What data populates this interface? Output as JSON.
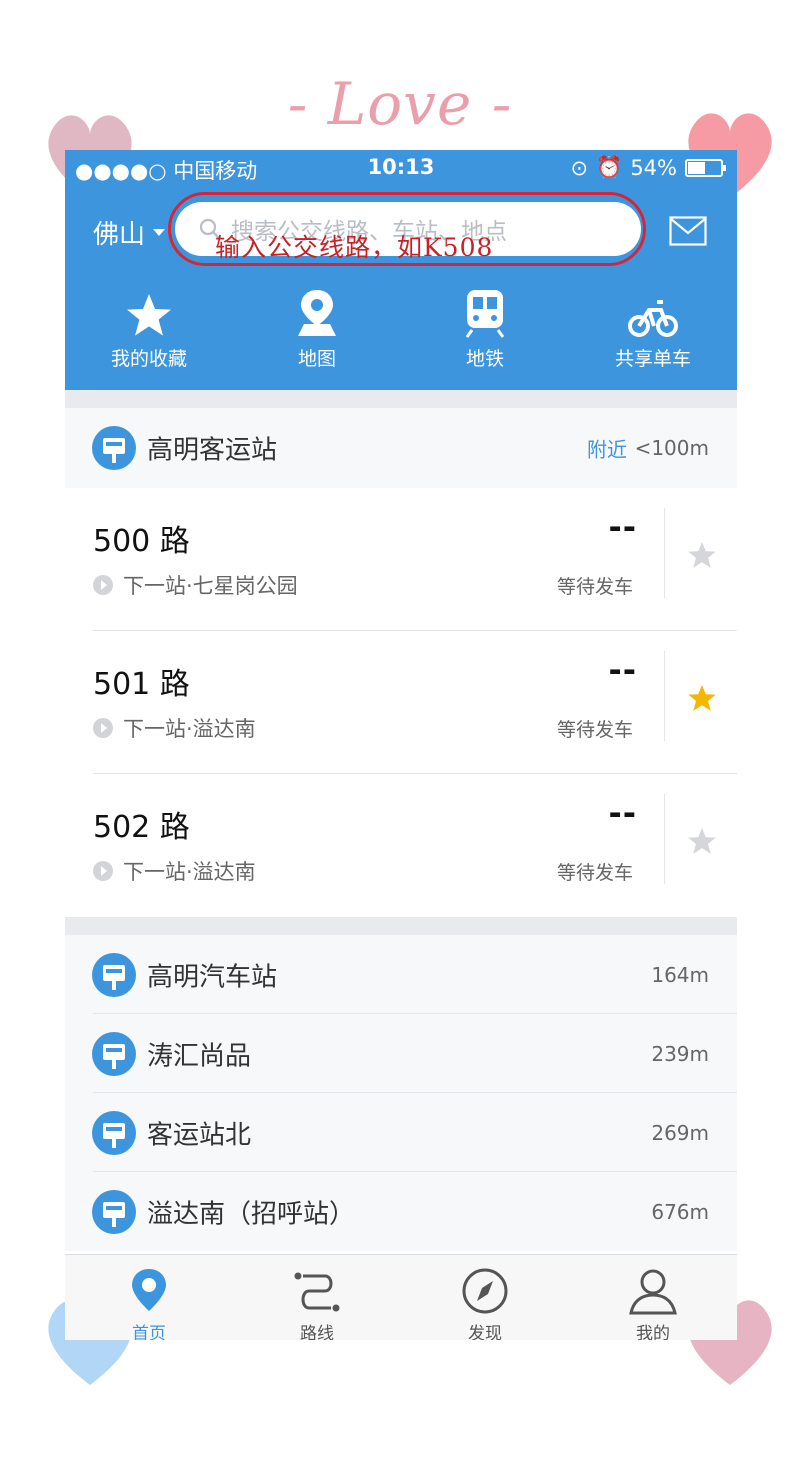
{
  "decor": {
    "love_text": "- Love -"
  },
  "status_bar": {
    "carrier": "●●●●○ 中国移动",
    "time": "10:13",
    "battery": "54%"
  },
  "header": {
    "city": "佛山",
    "search_placeholder": "搜索公交线路、车站、地点",
    "annotation": "输入公交线路，如K508"
  },
  "nav": [
    {
      "label": "我的收藏",
      "icon": "star-icon"
    },
    {
      "label": "地图",
      "icon": "map-pin-icon"
    },
    {
      "label": "地铁",
      "icon": "subway-icon"
    },
    {
      "label": "共享单车",
      "icon": "bicycle-icon"
    }
  ],
  "nearest_station": {
    "name": "高明客运站",
    "nearby_label": "附近",
    "distance": "<100m"
  },
  "routes": [
    {
      "number": "500 路",
      "next": "下一站·七星岗公园",
      "eta": "--",
      "status": "等待发车",
      "favorited": false
    },
    {
      "number": "501 路",
      "next": "下一站·溢达南",
      "eta": "--",
      "status": "等待发车",
      "favorited": true
    },
    {
      "number": "502 路",
      "next": "下一站·溢达南",
      "eta": "--",
      "status": "等待发车",
      "favorited": false
    }
  ],
  "stations": [
    {
      "name": "高明汽车站",
      "distance": "164m"
    },
    {
      "name": "涛汇尚品",
      "distance": "239m"
    },
    {
      "name": "客运站北",
      "distance": "269m"
    },
    {
      "name": "溢达南（招呼站）",
      "distance": "676m"
    }
  ],
  "tabs": [
    {
      "label": "首页",
      "icon": "home-pin-icon",
      "active": true
    },
    {
      "label": "路线",
      "icon": "route-icon",
      "active": false
    },
    {
      "label": "发现",
      "icon": "compass-icon",
      "active": false
    },
    {
      "label": "我的",
      "icon": "user-icon",
      "active": false
    }
  ],
  "colors": {
    "primary": "#3d96dd",
    "annotation_red": "#d3263a",
    "star_active": "#f5b800"
  }
}
